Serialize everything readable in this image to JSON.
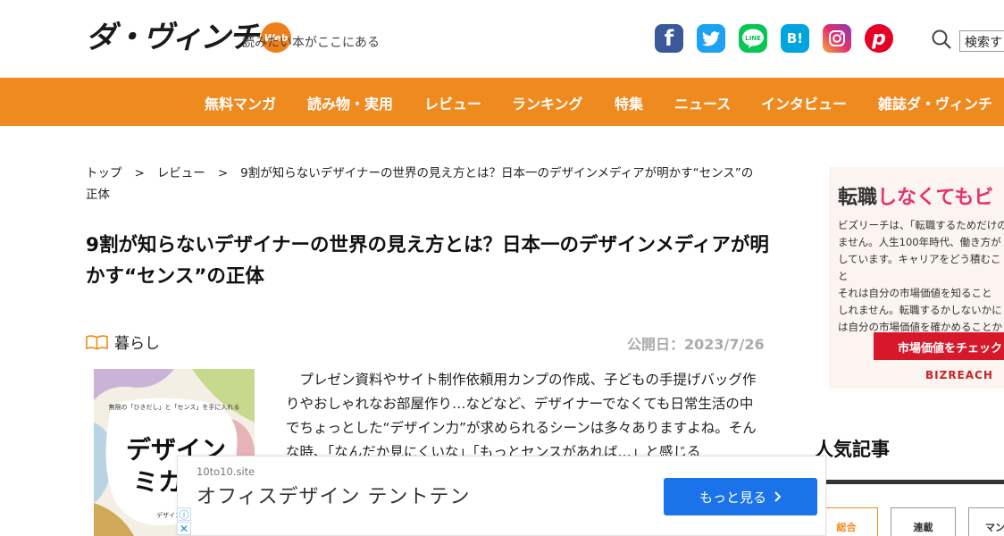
{
  "header": {
    "logo_text": "ダ・ヴィンチ",
    "logo_badge": "Web",
    "tagline": "読みたい本がここにある",
    "search_label": "検索す"
  },
  "social": [
    {
      "name": "facebook-icon",
      "glyph": "f"
    },
    {
      "name": "twitter-icon",
      "glyph": ""
    },
    {
      "name": "line-icon",
      "glyph": "LINE"
    },
    {
      "name": "hatena-bookmark-icon",
      "glyph": "B!"
    },
    {
      "name": "instagram-icon",
      "glyph": ""
    },
    {
      "name": "pinterest-icon",
      "glyph": "p"
    }
  ],
  "nav": {
    "items": [
      "無料マンガ",
      "読み物・実用",
      "レビュー",
      "ランキング",
      "特集",
      "ニュース",
      "インタビュー",
      "雑誌ダ・ヴィンチ"
    ]
  },
  "breadcrumb": {
    "home": "トップ",
    "section": "レビュー",
    "sep": ">",
    "current": "9割が知らないデザイナーの世界の見え方とは？日本一のデザインメディアが明かす“センス”の正体"
  },
  "article": {
    "title": "9割が知らないデザイナーの世界の見え方とは？日本一のデザインメディアが明かす“センス”の正体",
    "category": "暮らし",
    "pubdate": "公開日：2023/7/26",
    "body": "プレゼン資料やサイト制作依頼用カンプの作成、子どもの手提げバッグ作りやおしゃれなお部屋作り…などなど、デザイナーでなくても日常生活の中でちょっとした“デザイン力”が求められるシーンは多々ありますよね。そんな時、「なんだか見にくいな」「もっとセンスがあれば…」と感じる",
    "book_cover": {
      "subtitle": "無限の「ひきだし」と「センス」を手に入れる",
      "title_line1": "デザイン",
      "title_line2": "ミカ",
      "author": "デザイン"
    }
  },
  "side_ad": {
    "head_plain": "転職",
    "head_pink": "しなくても",
    "head_tail": "ビ",
    "body": "ビズリーチは、「転職するためだけの\nません。人生100年時代、働き方が\nしています。キャリアをどう積むこと\nそれは自分の市場価値を知ること\nしれません。転職するかしないかに\nは自分の市場価値を確かめることか",
    "button": "市場価値をチェック",
    "brand": "BIZREACH"
  },
  "popular": {
    "title": "人気記事",
    "tabs": [
      "総合",
      "連載",
      "マン"
    ]
  },
  "bottom_ad": {
    "domain": "10to10.site",
    "headline": "オフィスデザイン テントテン",
    "cta": "もっと見る",
    "info": "ⓘ",
    "close": "✕"
  }
}
